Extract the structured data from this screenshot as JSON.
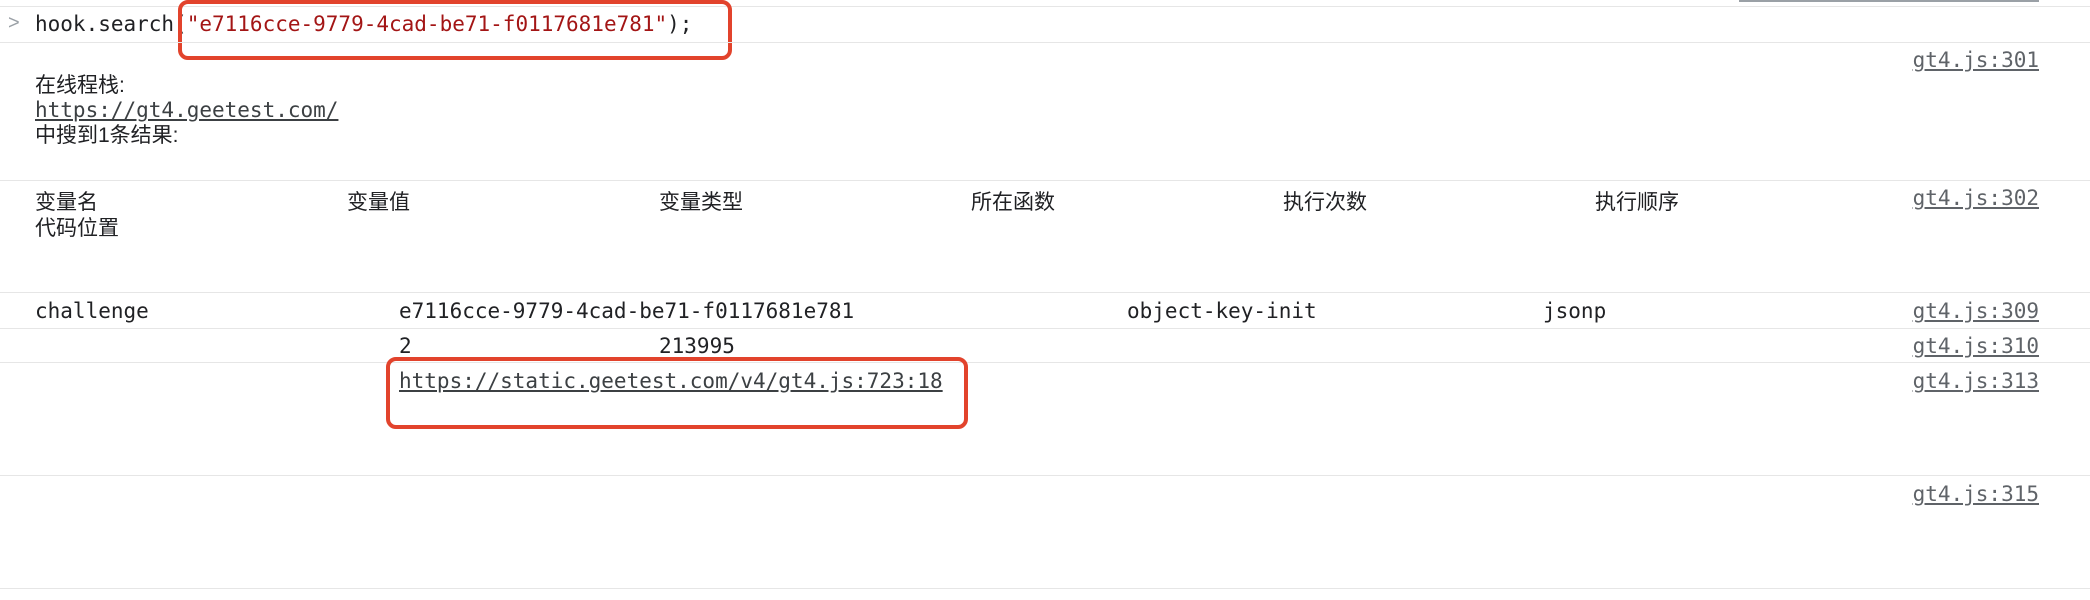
{
  "console": {
    "prompt_glyph": ">",
    "input": {
      "prefix": "hook.search(",
      "string_arg": "\"e7116cce-9779-4cad-be71-f0117681e781\"",
      "suffix": ");"
    },
    "message": {
      "line1": "在线程栈:",
      "url": "https://gt4.geetest.com/",
      "line3": "中搜到1条结果:"
    },
    "table_headers": [
      "变量名",
      "变量值",
      "变量类型",
      "所在函数",
      "执行次数",
      "执行顺序"
    ],
    "table_header_wrap": "代码位置",
    "row": {
      "name": "challenge",
      "value": "e7116cce-9779-4cad-be71-f0117681e781",
      "type": "object-key-init",
      "function": "jsonp",
      "exec_count": "2",
      "exec_order": "213995",
      "location": "https://static.geetest.com/v4/gt4.js:723:18"
    },
    "sources": [
      "gt4.js:301",
      "gt4.js:302",
      "gt4.js:309",
      "gt4.js:310",
      "gt4.js:313",
      "gt4.js:315"
    ]
  },
  "colors": {
    "highlight_border": "#e2432c",
    "string_literal": "#a31515",
    "source_link": "#5f6368"
  }
}
